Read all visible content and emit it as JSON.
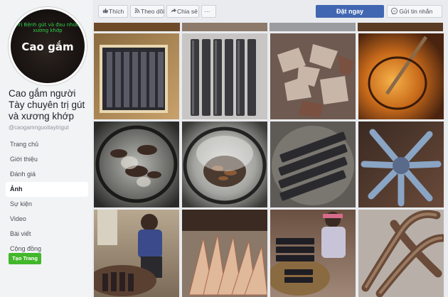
{
  "profile": {
    "overlay_text": "Trị Bệnh gút và đau nhức xương khớp",
    "logo_text": "Cao gắm"
  },
  "page": {
    "name": "Cao gắm người Tày chuyên trị gút và xương khớp",
    "handle": "@caogamnguoitaytrigut"
  },
  "nav": {
    "items": [
      "Trang chủ",
      "Giới thiệu",
      "Đánh giá",
      "Ảnh",
      "Sự kiện",
      "Video",
      "Bài viết",
      "Cộng đồng"
    ],
    "active": "Ảnh"
  },
  "create_page_label": "Tạo Trang",
  "toolbar": {
    "like_label": "Thích",
    "follow_label": "Theo dõi",
    "share_label": "Chia sẻ",
    "more_label": "···",
    "book_label": "Đặt ngay",
    "message_label": "Gửi tin nhắn"
  },
  "icons": {
    "like": "thumbs-up-icon",
    "follow": "rss-icon",
    "share": "share-icon",
    "message": "messenger-icon"
  },
  "colors": {
    "primary": "#4267b2",
    "create_button": "#42b72a",
    "profile_overlay": "#2fd14a"
  },
  "photos": [
    {
      "label": "Khay cao gắm đóng gói"
    },
    {
      "label": "Thanh cao gắm xếp hàng"
    },
    {
      "label": "Vỏ cây gắm thái lát"
    },
    {
      "label": "Nồi cao đang sắc"
    },
    {
      "label": "Chảo cao đang nấu"
    },
    {
      "label": "Nồi nước sắc bốc hơi"
    },
    {
      "label": "Mâm cao gắm thành phẩm"
    },
    {
      "label": "Gói cao gắm xếp hình hoa"
    },
    {
      "label": "Người phụ nữ phơi cao"
    },
    {
      "label": "Lát gắm phơi trên nia"
    },
    {
      "label": "Người phụ nữ gói cao"
    },
    {
      "label": "Rễ cây gắm"
    }
  ]
}
